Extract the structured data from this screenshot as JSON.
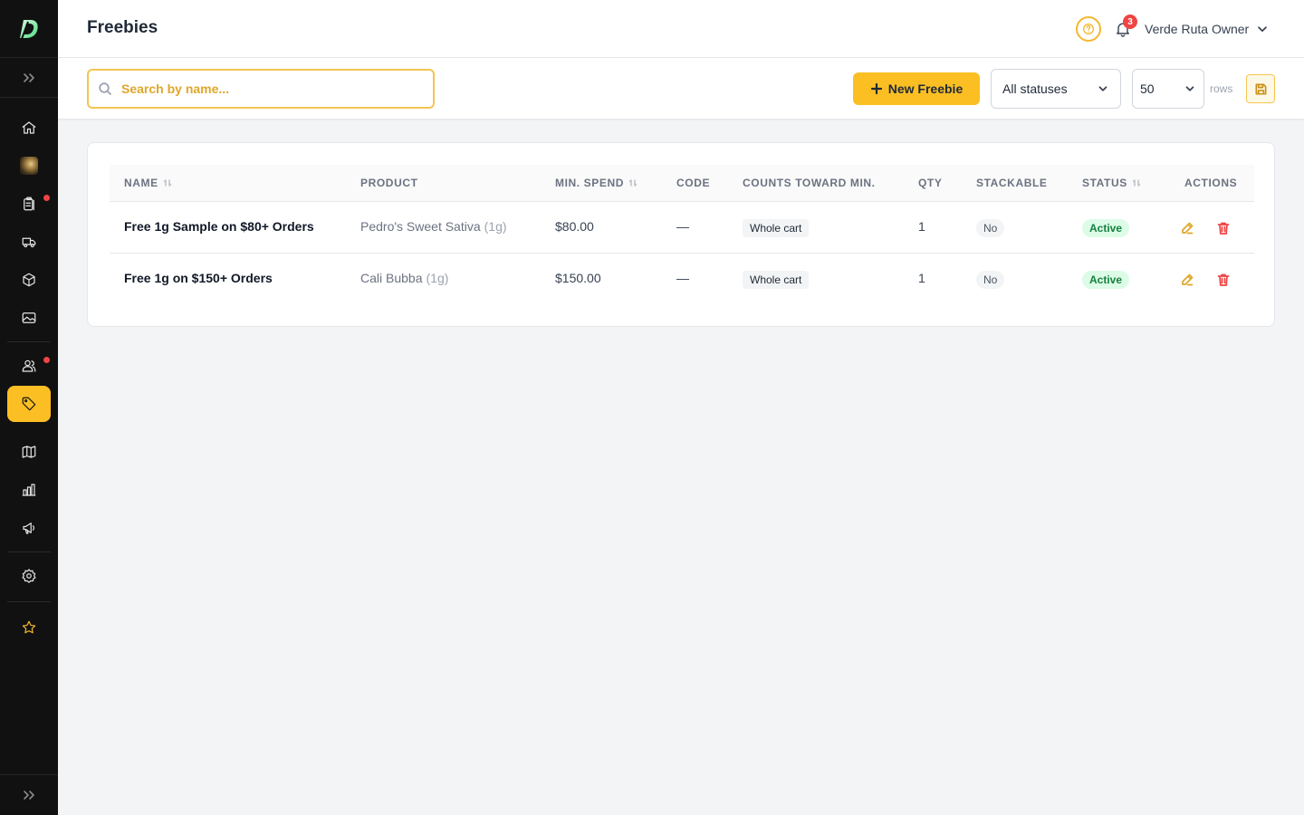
{
  "app": {
    "page_title": "Freebies",
    "notifications_count": "3",
    "user_name": "Verde Ruta Owner"
  },
  "toolbar": {
    "search_placeholder": "Search by name...",
    "new_button_label": "New Freebie",
    "status_filter": "All statuses",
    "rows_per_page": "50",
    "rows_label": "rows"
  },
  "table": {
    "columns": {
      "name": "NAME",
      "product": "PRODUCT",
      "min_spend": "MIN. SPEND",
      "code": "CODE",
      "counts_toward": "COUNTS TOWARD MIN.",
      "qty": "QTY",
      "stackable": "STACKABLE",
      "status": "STATUS",
      "actions": "ACTIONS"
    },
    "rows": [
      {
        "name": "Free 1g Sample on $80+ Orders",
        "product": "Pedro's Sweet Sativa",
        "product_size": "(1g)",
        "min_spend": "$80.00",
        "code": "—",
        "counts_toward": "Whole cart",
        "qty": "1",
        "stackable": "No",
        "status": "Active"
      },
      {
        "name": "Free 1g on $150+ Orders",
        "product": "Cali Bubba",
        "product_size": "(1g)",
        "min_spend": "$150.00",
        "code": "—",
        "counts_toward": "Whole cart",
        "qty": "1",
        "stackable": "No",
        "status": "Active"
      }
    ]
  },
  "colors": {
    "accent": "#fbbf24",
    "sidebar_bg": "#111111",
    "status_active": "#15803d",
    "danger": "#ef4444"
  },
  "icons": {
    "sidebar": [
      "home-icon",
      "store-avatar",
      "clipboard-icon",
      "truck-icon",
      "box-icon",
      "image-icon",
      "users-icon",
      "tag-icon",
      "map-icon",
      "bar-chart-icon",
      "megaphone-icon",
      "gear-icon",
      "star-icon"
    ],
    "header": [
      "help-icon",
      "bell-icon",
      "chevron-down-icon"
    ],
    "row_actions": [
      "edit-icon",
      "trash-icon"
    ]
  }
}
